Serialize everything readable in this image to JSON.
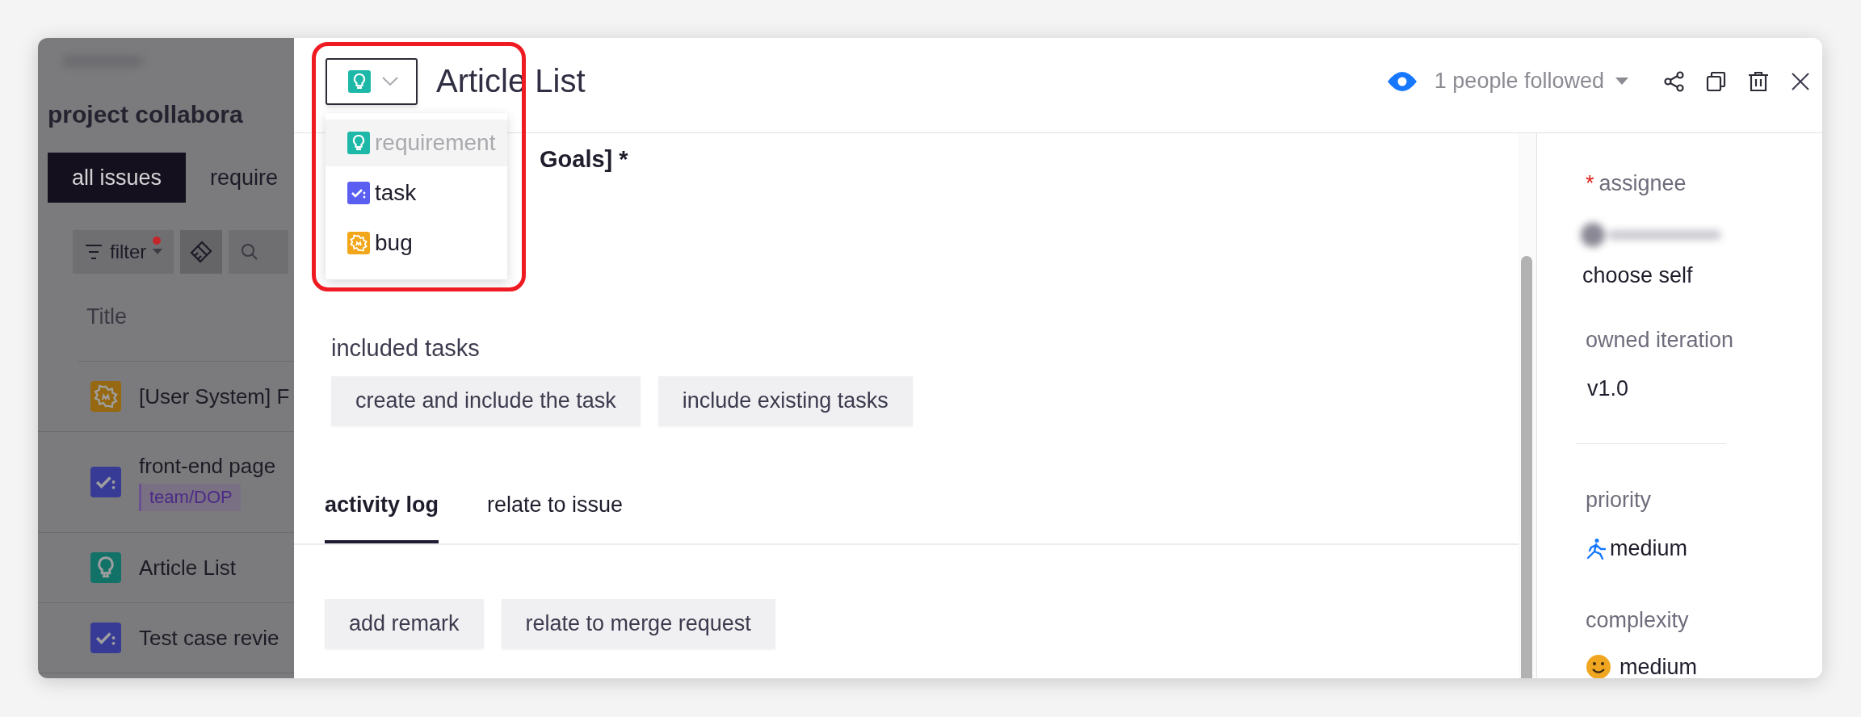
{
  "background_page": {
    "project_title": "project collabora",
    "tabs": [
      {
        "label": "all issues",
        "selected": true
      },
      {
        "label": "require",
        "selected": false
      }
    ],
    "filter": {
      "label": "filter",
      "active": true
    },
    "table": {
      "columns": [
        "Title"
      ],
      "rows": [
        {
          "kind": "bug",
          "title": "[User System] F"
        },
        {
          "kind": "task",
          "title": "front-end page",
          "tag": "team/DOP"
        },
        {
          "kind": "requirement",
          "title": "Article List"
        },
        {
          "kind": "task",
          "title": "Test case revie"
        }
      ]
    }
  },
  "drawer": {
    "type_select": {
      "kind": "requirement"
    },
    "title": "Article List",
    "followers": "1 people followed",
    "type_menu": [
      {
        "kind": "requirement",
        "label": "requirement",
        "selected": true
      },
      {
        "kind": "task",
        "label": "task",
        "selected": false
      },
      {
        "kind": "bug",
        "label": "bug",
        "selected": false
      }
    ],
    "description_fragments": [
      "Goals] *"
    ],
    "included_tasks": {
      "label": "included tasks",
      "buttons": [
        "create and include the task",
        "include existing tasks"
      ]
    },
    "tabs": [
      {
        "label": "activity log",
        "selected": true
      },
      {
        "label": "relate to issue",
        "selected": false
      }
    ],
    "actions": [
      "add remark",
      "relate to merge request"
    ]
  },
  "side_panel": {
    "assignee": {
      "label": "assignee",
      "required_mark": "*",
      "action": "choose self"
    },
    "iteration": {
      "label": "owned iteration",
      "value": "v1.0"
    },
    "priority": {
      "label": "priority",
      "value": "medium"
    },
    "complexity": {
      "label": "complexity",
      "value": "medium"
    }
  }
}
